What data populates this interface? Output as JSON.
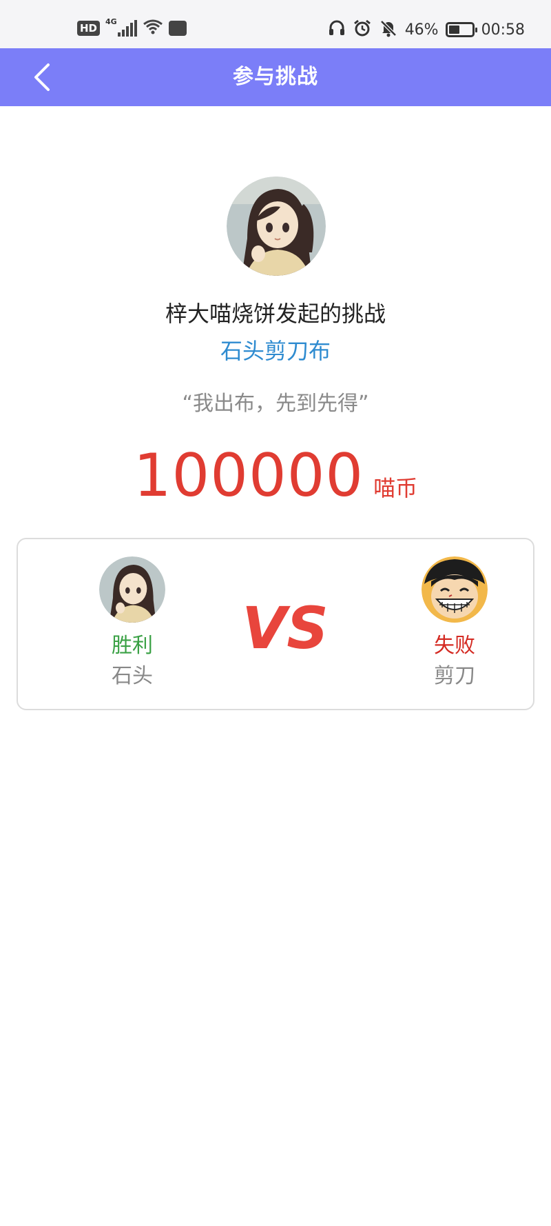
{
  "status_bar": {
    "hd": "HD",
    "network": "4G",
    "battery_percent": "46%",
    "battery_level": 0.46,
    "time": "00:58",
    "icons": [
      "hd-icon",
      "signal-icon",
      "wifi-icon",
      "huawei-share-icon",
      "headphones-icon",
      "alarm-icon",
      "mute-bell-icon",
      "battery-icon"
    ]
  },
  "nav": {
    "back_icon": "chevron-left-icon",
    "title": "参与挑战"
  },
  "challenge": {
    "challenger_line": "梓大喵烧饼发起的挑战",
    "game_name": "石头剪刀布",
    "quote": "“我出布，先到先得”",
    "stake_amount": "100000",
    "stake_unit": "喵币"
  },
  "versus": {
    "vs_label": "VS",
    "left_player": {
      "result": "胜利",
      "move": "石头"
    },
    "right_player": {
      "result": "失败",
      "move": "剪刀"
    }
  },
  "colors": {
    "nav_background": "#7b7ef8",
    "game_name": "#2e8bd0",
    "stake": "#e03c32",
    "win": "#3aa145",
    "lose": "#d42a22",
    "vs": "#e8453c"
  }
}
